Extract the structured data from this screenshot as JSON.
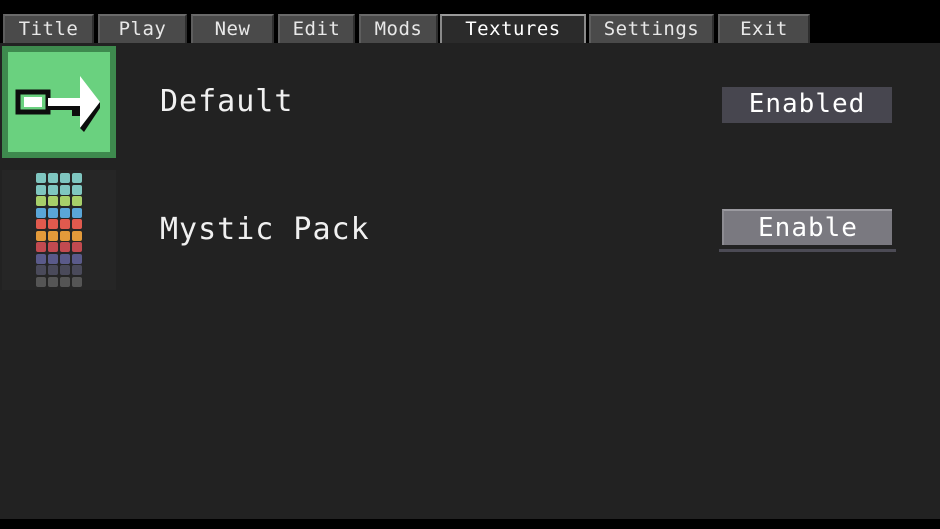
{
  "tabs": [
    {
      "label": "Title"
    },
    {
      "label": "Play"
    },
    {
      "label": "New"
    },
    {
      "label": "Edit"
    },
    {
      "label": "Mods"
    },
    {
      "label": "Textures"
    },
    {
      "label": "Settings"
    },
    {
      "label": "Exit"
    }
  ],
  "active_tab": "Textures",
  "packs": [
    {
      "name": "Default",
      "button_label": "Enabled",
      "icon": "exit-arrow-icon"
    },
    {
      "name": "Mystic Pack",
      "button_label": "Enable",
      "icon": "texture-grid-icon"
    }
  ],
  "colors": {
    "panel_bg": "#222222",
    "tab_bg": "#4a4a4a",
    "default_icon_green": "#6ad17f",
    "enabled_button": "#47464f",
    "enable_button": "#7a7980"
  }
}
